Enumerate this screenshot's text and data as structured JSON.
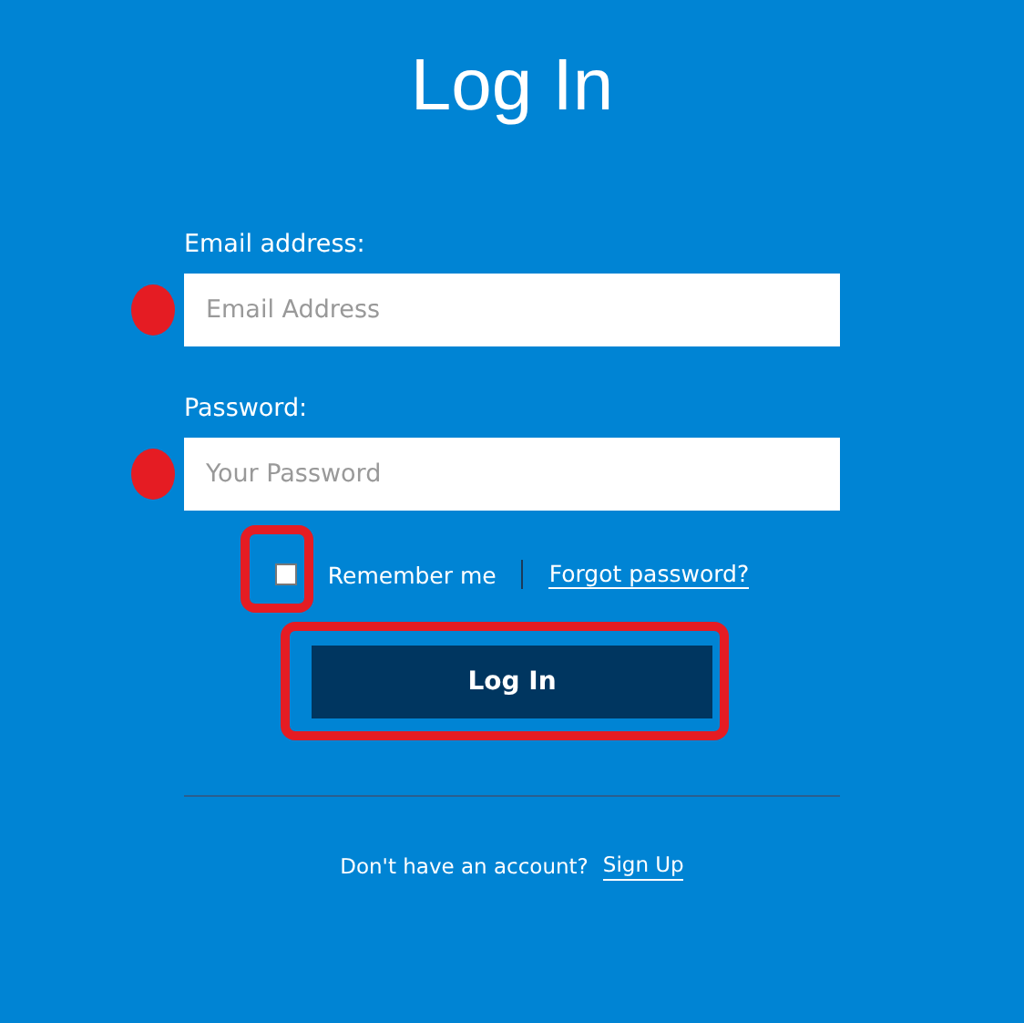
{
  "title": "Log In",
  "fields": [
    {
      "label": "Email address:",
      "placeholder": "Email Address",
      "mark": {
        "kind": "dot"
      }
    },
    {
      "label": "Password:",
      "placeholder": "Your Password",
      "mark": {
        "kind": "dot"
      }
    }
  ],
  "remember": {
    "label": "Remember me",
    "checked": false,
    "mark": {
      "kind": "outline"
    }
  },
  "forgot_link": "Forgot password?",
  "submit": {
    "label": "Log In",
    "mark": {
      "kind": "outline"
    }
  },
  "footer": {
    "text": "Don't have an account?",
    "link": "Sign Up"
  }
}
